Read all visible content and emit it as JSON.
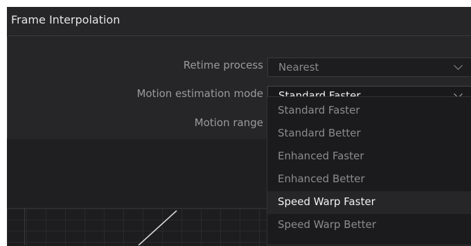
{
  "panel": {
    "title": "Frame Interpolation"
  },
  "fields": {
    "retime_process": {
      "label": "Retime process",
      "value": "Nearest"
    },
    "motion_estimation_mode": {
      "label": "Motion estimation mode",
      "value": "Standard Faster"
    },
    "motion_range": {
      "label": "Motion range"
    }
  },
  "dropdown": {
    "options": [
      "Standard Faster",
      "Standard Better",
      "Enhanced Faster",
      "Enhanced Better",
      "Speed Warp Faster",
      "Speed Warp Better"
    ],
    "hovered": "Speed Warp Faster"
  },
  "icons": {
    "dropdown_arrow": "chevron-down-icon"
  },
  "colors": {
    "panel_bg": "#1f1f21",
    "text_active": "#f2f2f2",
    "text_muted": "#8c8c8f"
  }
}
